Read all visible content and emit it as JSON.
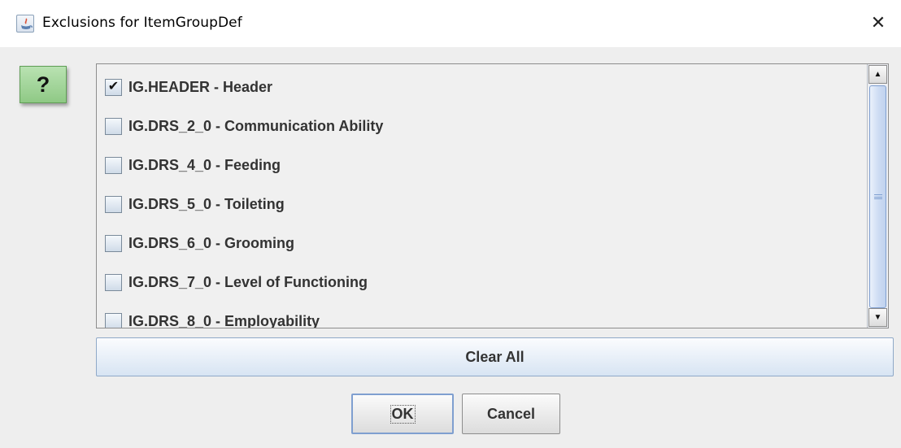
{
  "window": {
    "title": "Exclusions for ItemGroupDef",
    "app_icon": "java-icon",
    "close_glyph": "✕"
  },
  "help": {
    "label": "?"
  },
  "items": [
    {
      "label": "IG.HEADER - Header",
      "checked": true
    },
    {
      "label": "IG.DRS_2_0 - Communication Ability",
      "checked": false
    },
    {
      "label": "IG.DRS_4_0 - Feeding",
      "checked": false
    },
    {
      "label": "IG.DRS_5_0 - Toileting",
      "checked": false
    },
    {
      "label": "IG.DRS_6_0 - Grooming",
      "checked": false
    },
    {
      "label": "IG.DRS_7_0 - Level of Functioning",
      "checked": false
    },
    {
      "label": "IG.DRS_8_0 - Employability",
      "checked": false
    }
  ],
  "scrollbar": {
    "up_glyph": "▲",
    "down_glyph": "▼",
    "position_fraction": 0.0
  },
  "buttons": {
    "clear_all": "Clear All",
    "ok": "OK",
    "cancel": "Cancel"
  },
  "colors": {
    "help_button": "#9ed494",
    "clear_all_bg": "#d7e4f3",
    "scroll_thumb": "#c8daf3"
  }
}
